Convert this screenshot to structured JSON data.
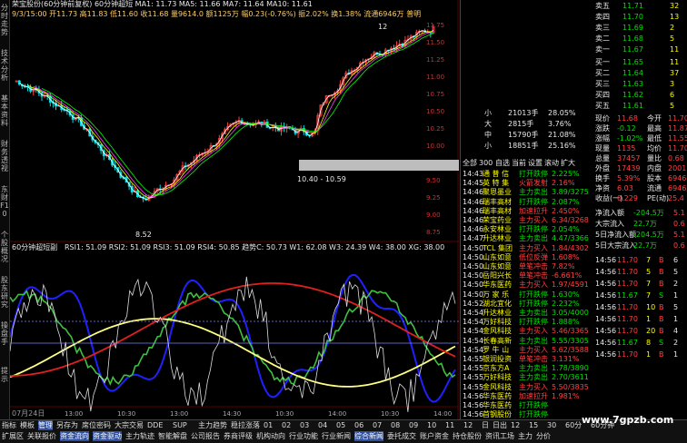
{
  "left_bar": [
    "分时走势",
    "技术分析",
    "基本资料",
    "财务透视",
    "东财F10",
    "个股概况",
    "股东研究",
    "操盘手",
    "提示"
  ],
  "header": {
    "line1": "荣宝股份(60分钟前复权) 60分钟超短 MA1: 11.73 MA5: 11.66 MA7: 11.64 MA10: 11.61",
    "line2": "9/3/15:00 开11.73 高11.83 低11.60 收11.68 量9614.0 额1125万 幅0.23(-0.76%) 振2.02% 换1.38% 流通6946万 普明",
    "price_high": "12",
    "price_low": "8.52",
    "range_label": "10.40 - 10.59",
    "indicator_title": "60分钟超短副",
    "indicator_values": "RSI1: 51.09 RSI2: 51.09 RSI3: 51.09 RSI4: 50.85 趋势C: 50.73 W1: 62.08 W3: 24.39 W4: 38.00 XG: 38.00",
    "date_label": "07月24日"
  },
  "y_axis": [
    "11.75",
    "11.50",
    "11.25",
    "11.00",
    "10.75",
    "10.50",
    "10.25",
    "10.00",
    "9.75",
    "9.50",
    "9.25",
    "9.00",
    "8.75"
  ],
  "x_axis": [
    "13:00",
    "10:30",
    "13:00",
    "14:30",
    "10:30",
    "14:00",
    "10:30",
    "14:00"
  ],
  "order_book": {
    "asks": [
      {
        "label": "卖五",
        "price": "11.71",
        "vol": "32"
      },
      {
        "label": "卖四",
        "price": "11.70",
        "vol": "13"
      },
      {
        "label": "卖三",
        "price": "11.69",
        "vol": "2"
      },
      {
        "label": "卖二",
        "price": "11.68",
        "vol": "5"
      },
      {
        "label": "卖一",
        "price": "11.67",
        "vol": "11"
      }
    ],
    "bids": [
      {
        "label": "买一",
        "price": "11.65",
        "vol": "11"
      },
      {
        "label": "买二",
        "price": "11.64",
        "vol": "37"
      },
      {
        "label": "买三",
        "price": "11.63",
        "vol": "3"
      },
      {
        "label": "买四",
        "price": "11.62",
        "vol": "6"
      },
      {
        "label": "买五",
        "price": "11.61",
        "vol": "5"
      }
    ]
  },
  "quote": [
    {
      "k1": "现价",
      "v1": "11.68",
      "k2": "今开",
      "v2": "11.70"
    },
    {
      "k1": "涨跌",
      "v1": "-0.12",
      "k2": "最高",
      "v2": "11.87"
    },
    {
      "k1": "涨幅",
      "v1": "-1.02%",
      "k2": "最低",
      "v2": "11.55"
    },
    {
      "k1": "现量",
      "v1": "1135",
      "k2": "均价",
      "v2": "11.70"
    },
    {
      "k1": "总量",
      "v1": "37457",
      "k2": "量比",
      "v2": "0.68"
    },
    {
      "k1": "外盘",
      "v1": "17439",
      "k2": "内盘",
      "v2": "20018"
    },
    {
      "k1": "换手",
      "v1": "5.39%",
      "k2": "股本",
      "v2": "6946万"
    },
    {
      "k1": "净资",
      "v1": "6.03",
      "k2": "流通",
      "v2": "6946万"
    },
    {
      "k1": "收益(一)",
      "v1": "0.229",
      "k2": "PE(动)",
      "v2": "25.4"
    }
  ],
  "flow": [
    {
      "k": "净流入额",
      "v": "-204.5万",
      "c": "5.1"
    },
    {
      "k": "大宗流入",
      "v": "22.7万",
      "c": "0.6"
    },
    {
      "k": "5日净流入额",
      "v": "-204.5万",
      "c": "5.1"
    },
    {
      "k": "5日大宗流入",
      "v": "22.7万",
      "c": "0.6"
    }
  ],
  "sector_panel": {
    "tabs": [
      "全部",
      "300",
      "自选",
      "当前",
      "设置",
      "滚动",
      "扩大"
    ],
    "buckets": [
      {
        "label": "小",
        "vol": "21013手",
        "pct": "28.05%"
      },
      {
        "label": "大",
        "vol": "2815手",
        "pct": "3.76%"
      },
      {
        "label": "中",
        "vol": "15790手",
        "pct": "21.08%"
      },
      {
        "label": "小",
        "vol": "18851手",
        "pct": "25.16%"
      }
    ],
    "rows": [
      {
        "t": "14:43",
        "name": "通 普 信",
        "tag": "打开跌停",
        "v": "2.225%"
      },
      {
        "t": "14:45",
        "name": "英 特 集",
        "tag": "火箭发射",
        "v": "2.16%"
      },
      {
        "t": "14:46",
        "name": "聚恩墨业",
        "tag": "主力卖出",
        "v": "3.89/3275"
      },
      {
        "t": "14:46",
        "name": "瑞丰高材",
        "tag": "打开跌停",
        "v": "2.087%"
      },
      {
        "t": "14:46",
        "name": "瑞丰高材",
        "tag": "加速拉升",
        "v": "2.450%"
      },
      {
        "t": "14:46",
        "name": "荣宝药业",
        "tag": "主力买入",
        "v": "6.34/3268"
      },
      {
        "t": "14:46",
        "name": "永安林业",
        "tag": "打开跌停",
        "v": "2.054%"
      },
      {
        "t": "14:47",
        "name": "升达林业",
        "tag": "主力卖出",
        "v": "4.47/3366"
      },
      {
        "t": "14:50",
        "name": "TCL 集团",
        "tag": "主力买入",
        "v": "1.84/4302"
      },
      {
        "t": "14:50",
        "name": "山东如意",
        "tag": "低位反弹",
        "v": "1.608%"
      },
      {
        "t": "14:50",
        "name": "山东如意",
        "tag": "单笔冲击",
        "v": "7.82%"
      },
      {
        "t": "14:50",
        "name": "岳阳兴长",
        "tag": "单笔冲击",
        "v": "-6.661%"
      },
      {
        "t": "14:50",
        "name": "华东医药",
        "tag": "主力买入",
        "v": "1.97/4591"
      },
      {
        "t": "14:50",
        "name": "万 家 乐",
        "tag": "打开跌停",
        "v": "1.630%"
      },
      {
        "t": "14:52",
        "name": "湖北宜化",
        "tag": "打开跌停",
        "v": "2.232%"
      },
      {
        "t": "14:54",
        "name": "升达林业",
        "tag": "主力卖出",
        "v": "3.05/4000"
      },
      {
        "t": "14:54",
        "name": "万好科技",
        "tag": "打开跌停",
        "v": "1.888%"
      },
      {
        "t": "14:54",
        "name": "金风科技",
        "tag": "主力买入",
        "v": "5.46/3365"
      },
      {
        "t": "14:54",
        "name": "长春高新",
        "tag": "主力卖出",
        "v": "5.55/3305"
      },
      {
        "t": "14:54",
        "name": "罗 牛 山",
        "tag": "主力买入",
        "v": "5.62/3588"
      },
      {
        "t": "14:55",
        "name": "银润投资",
        "tag": "单笔冲击",
        "v": "3.131%"
      },
      {
        "t": "14:55",
        "name": "京东方A",
        "tag": "主力卖出",
        "v": "1.78/3890"
      },
      {
        "t": "14:55",
        "name": "万好科技",
        "tag": "主力卖出",
        "v": "2.70/3611"
      },
      {
        "t": "14:55",
        "name": "金风科技",
        "tag": "主力买入",
        "v": "5.50/3835"
      },
      {
        "t": "14:56",
        "name": "华东医药",
        "tag": "加速拉升",
        "v": "1.981%"
      },
      {
        "t": "14:56",
        "name": "华东医药",
        "tag": "打开跌停",
        "v": ""
      },
      {
        "t": "14:56",
        "name": "首钢股份",
        "tag": "打开跌停",
        "v": ""
      }
    ]
  },
  "ticks": [
    {
      "t": "14:56",
      "p": "11.70",
      "v": "7",
      "d": "B",
      "n": "6"
    },
    {
      "t": "14:56",
      "p": "11.70",
      "v": "5",
      "d": "B",
      "n": "5"
    },
    {
      "t": "14:56",
      "p": "11.70",
      "v": "7",
      "d": "B",
      "n": "2"
    },
    {
      "t": "14:56",
      "p": "11.67",
      "v": "7",
      "d": "S",
      "n": "1"
    },
    {
      "t": "14:56",
      "p": "11.70",
      "v": "10",
      "d": "B",
      "n": "5"
    },
    {
      "t": "14:56",
      "p": "11.70",
      "v": "1",
      "d": "B",
      "n": "1"
    },
    {
      "t": "14:56",
      "p": "11.70",
      "v": "20",
      "d": "B",
      "n": "4"
    },
    {
      "t": "14:56",
      "p": "11.67",
      "v": "8",
      "d": "S",
      "n": "2"
    },
    {
      "t": "14:56",
      "p": "11.70",
      "v": "1",
      "d": "B",
      "n": "1"
    }
  ],
  "bottom_tabs_row1": [
    "指标",
    "模板",
    "管理",
    "另存为",
    "席位密码",
    "大宗交易",
    "DDE",
    "SUP",
    "主力趋势",
    "稳拉涨落",
    "01",
    "02",
    "03",
    "04",
    "05",
    "06",
    "07",
    "08",
    "09",
    "10",
    "11",
    "12",
    "日",
    "日出",
    "12",
    "15",
    "30",
    "60分",
    "60分钟"
  ],
  "bottom_tabs_row2": [
    "扩展区",
    "关联报价",
    "资金流向",
    "资金驱动",
    "主力轨迹",
    "智能解盘",
    "公司报告",
    "券商评级",
    "机构动向",
    "行业功能",
    "行业新闻",
    "综合新闻",
    "委托成交",
    "账户资金",
    "持仓股份",
    "资讯工场",
    "主力",
    "分价"
  ],
  "watermark": "www.7gpzb.com",
  "colors": {
    "up": "#ff4040",
    "down": "#00e0e0",
    "ma1": "#ffffff",
    "ma5": "#ffff00",
    "ma7": "#ff40ff",
    "ma10": "#00ff00",
    "rsi_blue": "#2020ff",
    "rsi_red": "#e02020",
    "rsi_green": "#40c040",
    "rsi_yellow": "#ffff80"
  }
}
